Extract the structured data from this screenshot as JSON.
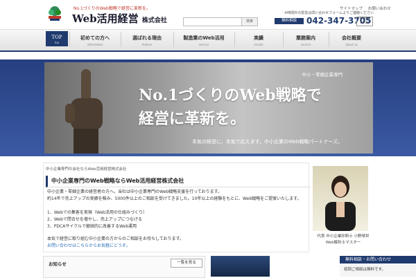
{
  "header": {
    "tagline": "No.1づくりのWeb戦略で経営に革新を。",
    "brand": "Web活用経営",
    "brand_suffix": "株式会社",
    "search_button": "検索",
    "search_placeholder": "",
    "top_links": [
      "サイトマップ",
      "お問い合わせ"
    ],
    "notice": "※時間外の緊急は問い合わせフォームよりご連絡ください",
    "free_badge": "無料相談",
    "phone": "042-347-3705",
    "hours": "9:30〜18:30"
  },
  "nav": [
    {
      "jp": "TOP",
      "en": "top"
    },
    {
      "jp": "初めての方へ",
      "en": "information"
    },
    {
      "jp": "選ばれる理由",
      "en": "feature"
    },
    {
      "jp": "製造業のWeb活用",
      "en": "service"
    },
    {
      "jp": "実績",
      "en": "results"
    },
    {
      "jp": "業務案内",
      "en": "service"
    },
    {
      "jp": "会社概要",
      "en": "about us"
    }
  ],
  "hero": {
    "label": "中小・零細企業専門",
    "line1": "No.1づくりのWeb戦略で",
    "line2": "経営に革新を。",
    "sub": "本気の経営に、本気で応えます。中小企業のWeb戦略パートナーズ。"
  },
  "main": {
    "breadcrumb": "中小企業専門の会社ならWeb活用経営株式会社",
    "title": "中小企業専門のWeb戦略ならWeb活用経営株式会社",
    "paragraphs": [
      "中小企業・零細企業の経営者の方へ。当社は中小企業専門のWeb戦略支援を行っております。",
      "約14年で売上アップの実績を積み、5000件以上のご相談を受けてきました。10年以上の経験をもとに、Web戦略をご提案いたします。",
      "",
      "1．Webでの集客を実現（Web活用の仕組みづくり）",
      "2．Webで問合せを増やし、売上アップにつなげる",
      "3．PDCAサイクルで継続的に改善するWeb運用",
      "",
      "本気で経営に取り組む中小企業の方からのご相談をお待ちしております。",
      "お問い合わせはこちらからお気軽にどうぞ。"
    ],
    "highlight_1": "5000件",
    "highlight_2": "10年以上",
    "link_text": "お問い合わせ"
  },
  "profile": {
    "caption_1": "代表 中小企業診断士 小野晴世",
    "caption_2": "Web解析士マスター"
  },
  "news": {
    "title": "お知らせ",
    "more_button": "一覧を見る"
  },
  "inquiry": {
    "title": "無料相談・お問い合わせ",
    "body": "初回ご相談は無料です。"
  }
}
